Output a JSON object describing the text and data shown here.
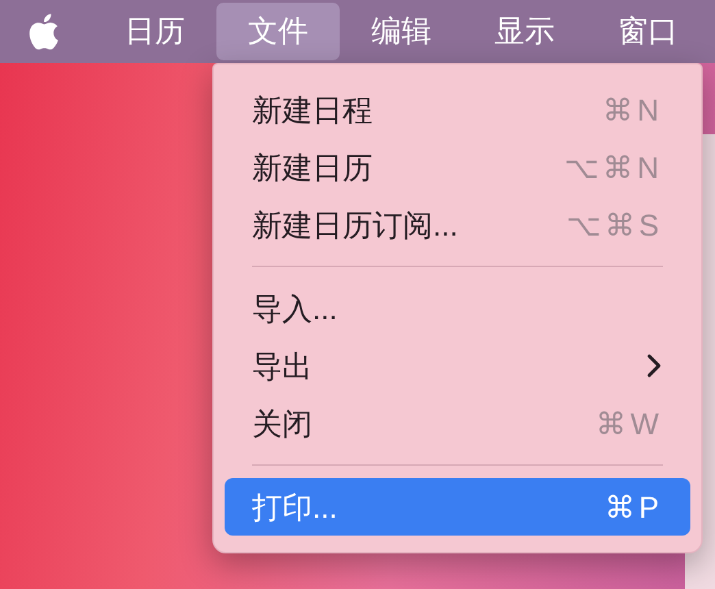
{
  "menu_bar": {
    "items": [
      {
        "kind": "apple",
        "selected": false
      },
      {
        "kind": "text",
        "label": "日历",
        "selected": false
      },
      {
        "kind": "text",
        "label": "文件",
        "selected": true
      },
      {
        "kind": "text",
        "label": "编辑",
        "selected": false
      },
      {
        "kind": "text",
        "label": "显示",
        "selected": false
      },
      {
        "kind": "text",
        "label": "窗口",
        "selected": false
      }
    ]
  },
  "menu": {
    "items": [
      {
        "kind": "item",
        "label": "新建日程",
        "shortcut": "⌘N",
        "selected": false
      },
      {
        "kind": "item",
        "label": "新建日历",
        "shortcut": "⌥⌘N",
        "selected": false
      },
      {
        "kind": "item",
        "label": "新建日历订阅...",
        "shortcut": "⌥⌘S",
        "selected": false
      },
      {
        "kind": "separator"
      },
      {
        "kind": "item",
        "label": "导入...",
        "selected": false
      },
      {
        "kind": "submenu",
        "label": "导出",
        "selected": false
      },
      {
        "kind": "item",
        "label": "关闭",
        "shortcut": "⌘W",
        "selected": false
      },
      {
        "kind": "separator"
      },
      {
        "kind": "item",
        "label": "打印...",
        "shortcut": "⌘P",
        "selected": true
      }
    ]
  }
}
